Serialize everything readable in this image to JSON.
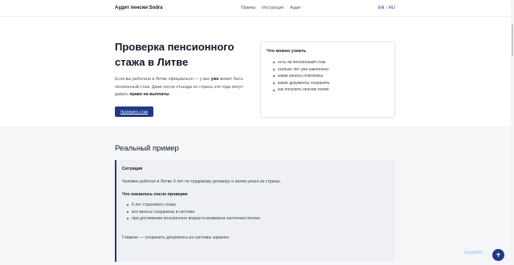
{
  "header": {
    "brand": "Аудит пенсии Sodra",
    "nav": [
      "Пример",
      "Инструкция",
      "Аудит"
    ],
    "lang_en": "EN",
    "lang_sep": "/",
    "lang_ru": "RU"
  },
  "hero": {
    "title": "Проверка пенсионного стажа в Литве",
    "text_part1": "Если вы работали в Литве официально — у вас ",
    "text_bold1": "уже",
    "text_part2": " может быть пенсионный стаж. Даже после отъезда из страны эти годы могут давать ",
    "text_bold2": "право на выплаты",
    "text_part3": ".",
    "cta": "Проверить стаж"
  },
  "card": {
    "title": "Что можно узнать",
    "items": [
      "есть ли пенсионный стаж",
      "сколько лет уже накоплено",
      "какие взносы платились",
      "какие документы сохранить",
      "как получить пенсию позже"
    ]
  },
  "example": {
    "section_title": "Реальный пример",
    "situation_label": "Ситуация",
    "situation_text": "Человек работал в Литве 6 лет по трудовому договору и затем уехал из страны.",
    "result_label": "Что оказалось после проверки",
    "results": [
      "6 лет страхового стажа",
      "все взносы сохранены в системе",
      "при достижении пенсионного возраста возможна частичная пенсия"
    ],
    "conclusion": "Главное — сохранить документы из системы заранее."
  },
  "watermark": "ScanMo",
  "colors": {
    "accent": "#1e3a8a",
    "section_bg": "#f5f6f8"
  },
  "icons": {
    "scroll_top": "arrow-up-icon"
  }
}
